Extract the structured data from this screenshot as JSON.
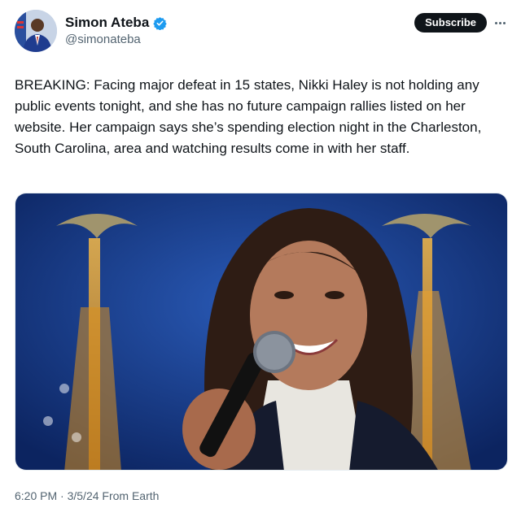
{
  "author": {
    "display_name": "Simon Ateba",
    "handle": "@simonateba",
    "verified": true,
    "verified_color": "#1d9bf0"
  },
  "actions": {
    "subscribe_label": "Subscribe",
    "more_icon": "more-horizontal-icon"
  },
  "tweet": {
    "text": "BREAKING: Facing major defeat in 15 states, Nikki Haley is not holding any public events tonight, and she has no future campaign rallies listed on her website. Her campaign says she’s spending election night in the Charleston, South Carolina, area and watching results come in with her staff."
  },
  "meta": {
    "time": "6:20 PM",
    "separator": "·",
    "date": "3/5/24",
    "source": "From Earth"
  },
  "colors": {
    "text": "#0f1419",
    "secondary": "#536471",
    "subscribe_bg": "#0f1419",
    "photo_background": "#14357a"
  }
}
